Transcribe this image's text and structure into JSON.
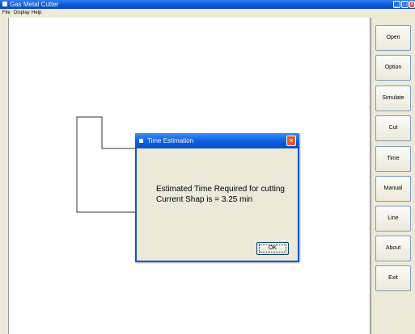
{
  "window": {
    "title": "Gas Metal Cutter"
  },
  "menu": {
    "items": [
      "File",
      "Display",
      "Help"
    ]
  },
  "sidebar": {
    "buttons": [
      "Open",
      "Option",
      "Simulate",
      "Cut",
      "Time",
      "Manual",
      "Line",
      "About",
      "Exit"
    ]
  },
  "dialog": {
    "title": "Time Estimation",
    "message_line1": "Estimated Time Required for cutting",
    "message_line2": "Current Shap is = 3.25 min",
    "ok_label": "OK"
  },
  "colors": {
    "titlebar": "#0a56d8",
    "close_button": "#e05a2e",
    "panel": "#ece9d8"
  }
}
